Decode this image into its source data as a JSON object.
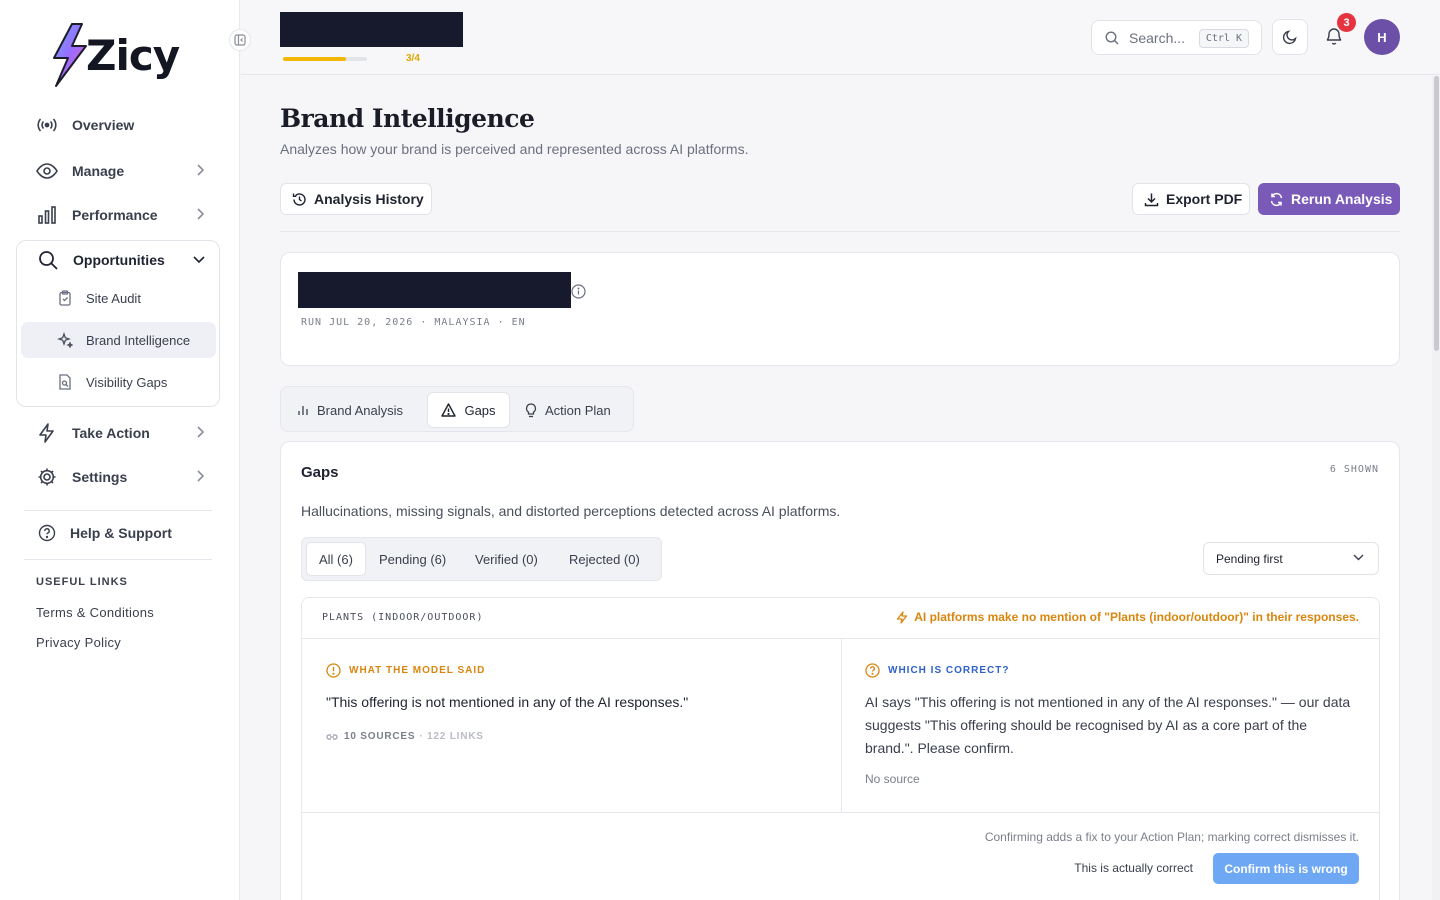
{
  "brand": {
    "name": "Zicy"
  },
  "sidebar": {
    "items": [
      {
        "label": "Overview",
        "icon": "broadcast-icon"
      },
      {
        "label": "Manage",
        "icon": "eye-icon"
      },
      {
        "label": "Performance",
        "icon": "bar-chart-icon"
      },
      {
        "label": "Opportunities",
        "icon": "search-icon"
      },
      {
        "label": "Take Action",
        "icon": "lightning-icon"
      },
      {
        "label": "Settings",
        "icon": "gear-icon"
      },
      {
        "label": "Help & Support",
        "icon": "help-circle-icon"
      }
    ],
    "sub_items": [
      {
        "label": "Site Audit",
        "icon": "clipboard-icon"
      },
      {
        "label": "Brand Intelligence",
        "icon": "sparkles-icon"
      },
      {
        "label": "Visibility Gaps",
        "icon": "file-search-icon"
      }
    ],
    "useful_links_title": "USEFUL LINKS",
    "useful_links": [
      "Terms & Conditions",
      "Privacy Policy"
    ]
  },
  "topbar": {
    "progress_label": "3/4",
    "progress_fraction": 0.75,
    "search_placeholder": "Search...",
    "search_shortcut": "Ctrl K",
    "notification_count": "3",
    "avatar_initial": "H"
  },
  "page": {
    "title": "Brand Intelligence",
    "subtitle": "Analyzes how your brand is perceived and represented across AI platforms.",
    "history_button": "Analysis History",
    "export_button": "Export PDF",
    "rerun_button": "Rerun Analysis",
    "run_meta": "RUN JUL 20, 2026 · MALAYSIA · EN"
  },
  "tabs": [
    {
      "label": "Brand Analysis",
      "icon": "bar-chart-icon"
    },
    {
      "label": "Gaps",
      "icon": "warning-icon"
    },
    {
      "label": "Action Plan",
      "icon": "lightbulb-icon"
    }
  ],
  "gaps": {
    "title": "Gaps",
    "shown_count": "6 SHOWN",
    "description": "Hallucinations, missing signals, and distorted perceptions detected across AI platforms.",
    "filters": [
      "All (6)",
      "Pending (6)",
      "Verified (0)",
      "Rejected (0)"
    ],
    "sort_selected": "Pending first",
    "item": {
      "topic": "PLANTS (INDOOR/OUTDOOR)",
      "alert": "AI platforms make no mention of \"Plants (indoor/outdoor)\" in their responses.",
      "model_label": "WHAT THE MODEL SAID",
      "model_quote": "\"This offering is not mentioned in any of the AI responses.\"",
      "sources": "10 SOURCES",
      "links": "· 122 LINKS",
      "correct_label": "WHICH IS CORRECT?",
      "correct_text": "AI says \"This offering is not mentioned in any of the AI responses.\" — our data suggests \"This offering should be recognised by AI as a core part of the brand.\". Please confirm.",
      "no_source": "No source",
      "footer_note": "Confirming adds a fix to your Action Plan; marking correct dismisses it.",
      "actually_correct": "This is actually correct",
      "confirm_wrong": "Confirm this is wrong"
    }
  },
  "colors": {
    "accent": "#7a5ab8",
    "warning": "#d9860f",
    "info": "#2f62c7",
    "progress": "#f2b705",
    "notification": "#e5343f"
  }
}
